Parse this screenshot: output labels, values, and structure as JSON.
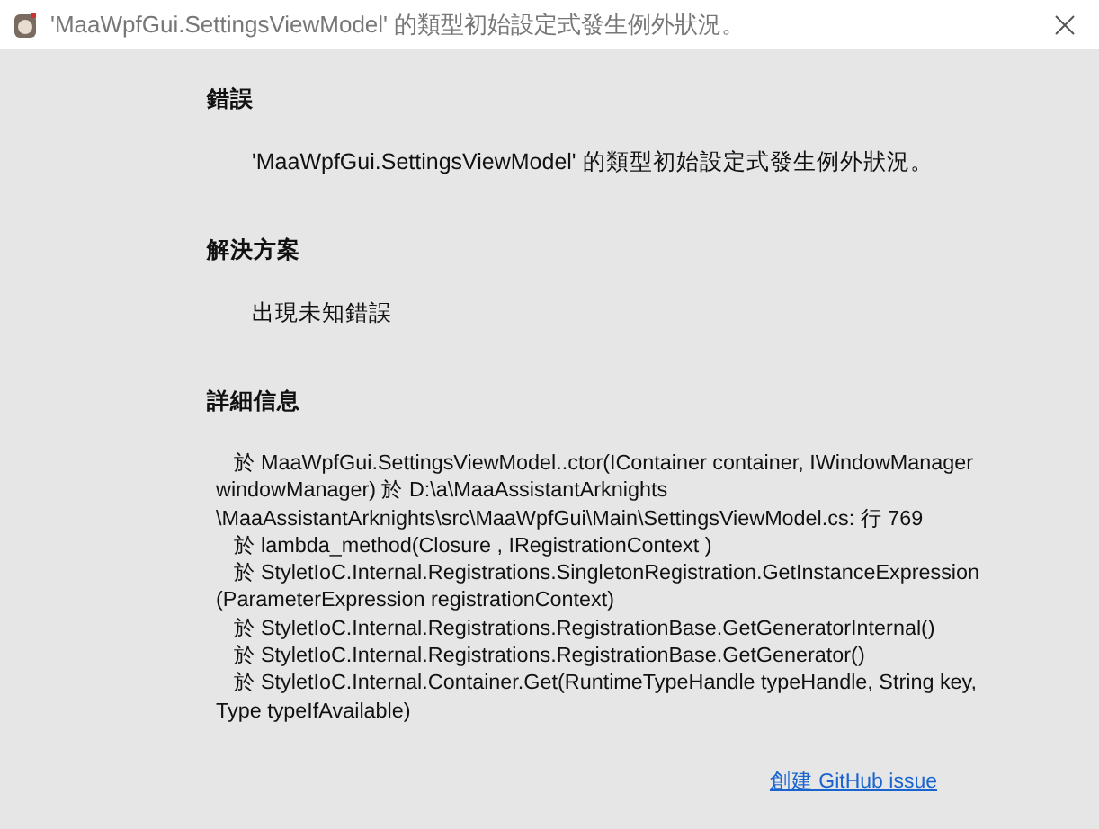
{
  "window": {
    "title": "'MaaWpfGui.SettingsViewModel' 的類型初始設定式發生例外狀況。"
  },
  "sections": [
    {
      "heading": "錯誤",
      "text": "'MaaWpfGui.SettingsViewModel' 的類型初始設定式發生例外狀況。"
    },
    {
      "heading": "解決方案",
      "text": "出現未知錯誤"
    }
  ],
  "details": {
    "heading": "詳細信息",
    "text": "   於 MaaWpfGui.SettingsViewModel..ctor(IContainer container, IWindowManager windowManager) 於 D:\\a\\MaaAssistantArknights \\MaaAssistantArknights\\src\\MaaWpfGui\\Main\\SettingsViewModel.cs: 行 769\n   於 lambda_method(Closure , IRegistrationContext )\n   於 StyletIoC.Internal.Registrations.SingletonRegistration.GetInstanceExpression (ParameterExpression registrationContext)\n   於 StyletIoC.Internal.Registrations.RegistrationBase.GetGeneratorInternal()\n   於 StyletIoC.Internal.Registrations.RegistrationBase.GetGenerator()\n   於 StyletIoC.Internal.Container.Get(RuntimeTypeHandle typeHandle, String key, Type typeIfAvailable)"
  },
  "link": {
    "label": "創建 GitHub issue"
  }
}
